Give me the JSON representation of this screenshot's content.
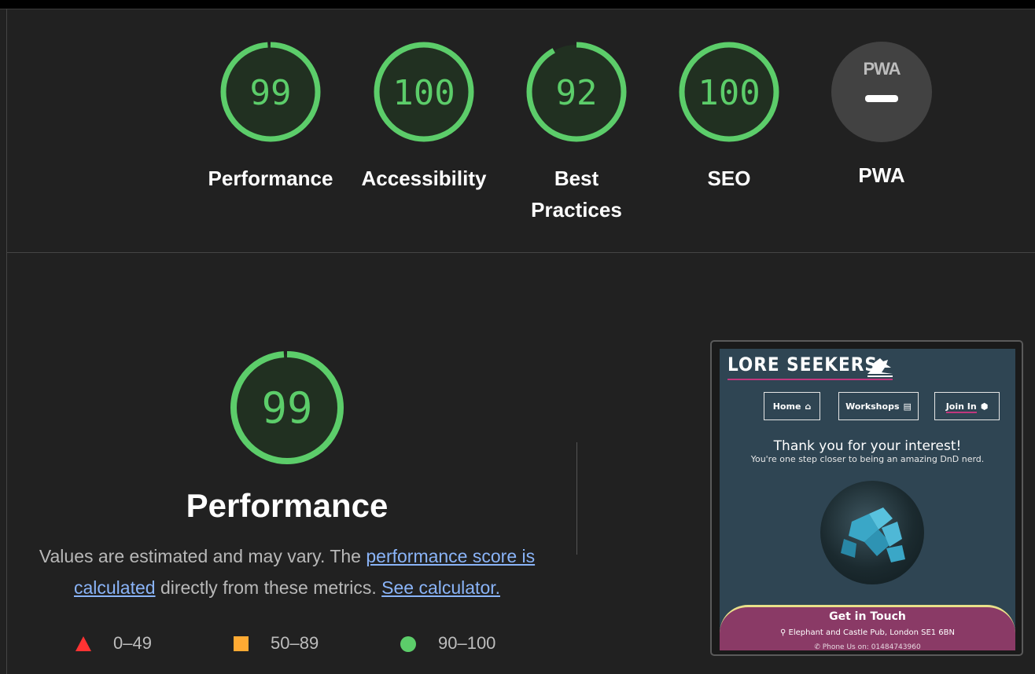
{
  "colors": {
    "pass": "#5ccd6a",
    "average": "#ffaa33",
    "fail": "#ff3333",
    "background": "#212121",
    "link": "#8ab4f8"
  },
  "categories": [
    {
      "id": "performance",
      "score": "99",
      "label": "Performance"
    },
    {
      "id": "accessibility",
      "score": "100",
      "label": "Accessibility"
    },
    {
      "id": "best-practices",
      "score": "92",
      "label_line1": "Best",
      "label_line2": "Practices"
    },
    {
      "id": "seo",
      "score": "100",
      "label": "SEO"
    },
    {
      "id": "pwa",
      "badge_text": "PWA",
      "label": "PWA"
    }
  ],
  "performance_section": {
    "score": "99",
    "title": "Performance",
    "desc_prefix": "Values are estimated and may vary. The ",
    "desc_link1": "performance score is calculated",
    "desc_mid": " directly from these metrics. ",
    "desc_link2": "See calculator."
  },
  "legend": [
    {
      "shape": "triangle",
      "range": "0–49"
    },
    {
      "shape": "square",
      "range": "50–89"
    },
    {
      "shape": "circle",
      "range": "90–100"
    }
  ],
  "screenshot": {
    "brand": "LORE SEEKERS",
    "nav": [
      {
        "label": "Home",
        "icon": "home-icon"
      },
      {
        "label": "Workshops",
        "icon": "book-icon"
      },
      {
        "label": "Join In",
        "icon": "d20-icon"
      }
    ],
    "heading": "Thank you for your interest!",
    "subheading": "You're one step closer to being an amazing DnD nerd.",
    "footer_title": "Get in Touch",
    "footer_address": "Elephant and Castle Pub, London SE1 6BN",
    "footer_phone": "Phone Us on: 01484743960"
  }
}
